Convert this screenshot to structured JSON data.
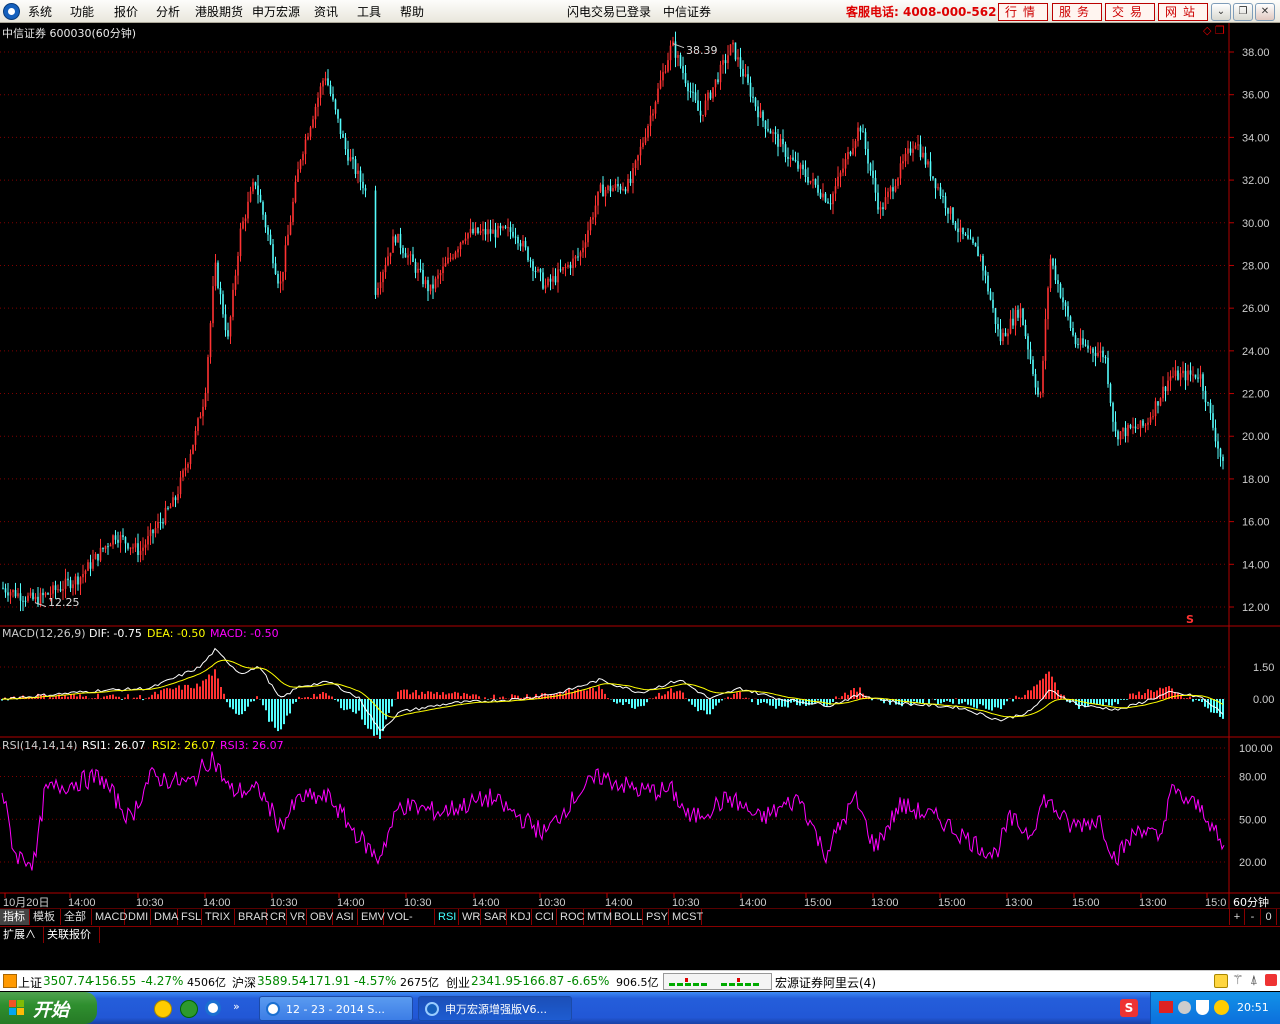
{
  "menu": {
    "items": [
      "系统",
      "功能",
      "报价",
      "分析",
      "港股期货",
      "申万宏源",
      "资讯",
      "工具",
      "帮助"
    ],
    "login_status": "闪电交易已登录",
    "broker": "中信证券",
    "hotline": "客服电话: 4008-000-562",
    "buttons": [
      "行情",
      "服务",
      "交易",
      "网站"
    ]
  },
  "window_controls": {
    "minimize": "⌄",
    "restore": "❐",
    "close": "✕"
  },
  "chart": {
    "title": "中信证券 600030(60分钟)",
    "high_label": "38.39",
    "low_label": "12.25",
    "s_marker": "S",
    "price_ticks": [
      "38.00",
      "36.00",
      "34.00",
      "32.00",
      "30.00",
      "28.00",
      "26.00",
      "24.00",
      "22.00",
      "20.00",
      "18.00",
      "16.00",
      "14.00",
      "12.00"
    ],
    "macd": {
      "name": "MACD(12,26,9)",
      "dif": "DIF: -0.75",
      "dea": "DEA: -0.50",
      "macd": "MACD: -0.50",
      "ticks": [
        "1.50",
        "0.00"
      ]
    },
    "rsi": {
      "name": "RSI(14,14,14)",
      "rsi1": "RSI1: 26.07",
      "rsi2": "RSI2: 26.07",
      "rsi3": "RSI3: 26.07",
      "ticks": [
        "100.00",
        "80.00",
        "50.00",
        "20.00"
      ]
    },
    "time_labels": [
      "10月20日",
      "14:00",
      "10:30",
      "14:00",
      "10:30",
      "14:00",
      "10:30",
      "14:00",
      "10:30",
      "14:00",
      "10:30",
      "14:00",
      "15:00",
      "13:00",
      "15:00",
      "13:00",
      "15:00",
      "13:00",
      "15:0"
    ],
    "period_label": "60分钟",
    "colors": {
      "up": "#ff3232",
      "down": "#54fcfc",
      "dif": "#ffffff",
      "dea": "#ffff00",
      "macd": "#ff00ff",
      "rsi": "#ff00ff",
      "grid": "#800000"
    }
  },
  "tabs": [
    "指标",
    "模板",
    "全部",
    "MACD",
    "DMI",
    "DMA",
    "FSL",
    "TRIX",
    "BRAR",
    "CR",
    "VR",
    "OBV",
    "ASI",
    "EMV",
    "VOL-TDX",
    "RSI",
    "WR",
    "SAR",
    "KDJ",
    "CCI",
    "ROC",
    "MTM",
    "BOLL",
    "PSY",
    "MCST"
  ],
  "tab_controls": [
    "+",
    "-",
    "0"
  ],
  "ext_tabs": [
    "扩展∧",
    "关联报价"
  ],
  "index_bar": {
    "sh_name": "上证",
    "sh_value": "3507.74",
    "sh_change": "-156.55",
    "sh_pct": "-4.27%",
    "sh_amount": "4506亿",
    "hs_name": "沪深",
    "hs_value": "3589.54",
    "hs_change": "-171.91",
    "hs_pct": "-4.57%",
    "hs_amount": "2675亿",
    "cy_name": "创业",
    "cy_value": "2341.95",
    "cy_change": "-166.87",
    "cy_pct": "-6.65%",
    "cy_amount": "906.5亿",
    "server": "宏源证券阿里云(4)"
  },
  "taskbar": {
    "start": "开始",
    "tasks": [
      "12 - 23 - 2014 S...",
      "申万宏源增强版V6..."
    ],
    "clock": "20:51"
  }
}
